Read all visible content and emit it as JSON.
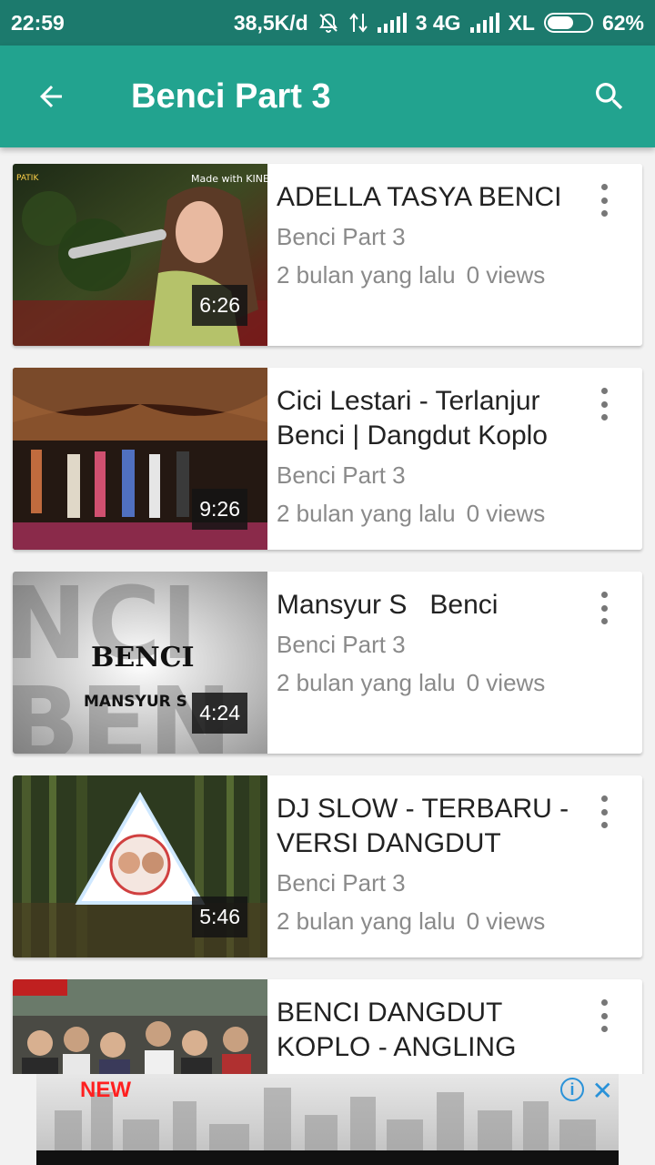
{
  "status_bar": {
    "time": "22:59",
    "speed": "38,5K/d",
    "sim1": "3 4G",
    "carrier": "XL",
    "battery": "62%",
    "battery_level": 0.62
  },
  "app_bar": {
    "title": "Benci Part 3",
    "back_icon": "arrow-back-icon",
    "search_icon": "search-icon"
  },
  "videos": [
    {
      "title": "ADELLA TASYA BENCI",
      "channel": "Benci Part 3",
      "age": "2 bulan yang lalu",
      "views": "0 views",
      "duration": "6:26"
    },
    {
      "title": "Cici Lestari - Terlanjur Benci | Dangdut Koplo",
      "channel": "Benci Part 3",
      "age": "2 bulan yang lalu",
      "views": "0 views",
      "duration": "9:26"
    },
    {
      "title": "Mansyur S   Benci",
      "channel": "Benci Part 3",
      "age": "2 bulan yang lalu",
      "views": "0 views",
      "duration": "4:24",
      "thumb_text_1": "BENCI",
      "thumb_text_2": "MANSYUR S"
    },
    {
      "title": "DJ SLOW - TERBARU - VERSI DANGDUT",
      "channel": "Benci Part 3",
      "age": "2 bulan yang lalu",
      "views": "0 views",
      "duration": "5:46"
    },
    {
      "title": "BENCI DANGDUT KOPLO - ANGLING",
      "channel": "",
      "age": "",
      "views": "",
      "duration": ""
    }
  ],
  "ad": {
    "badge": "NEW",
    "info_icon": "info-icon",
    "close_icon": "close-icon"
  }
}
